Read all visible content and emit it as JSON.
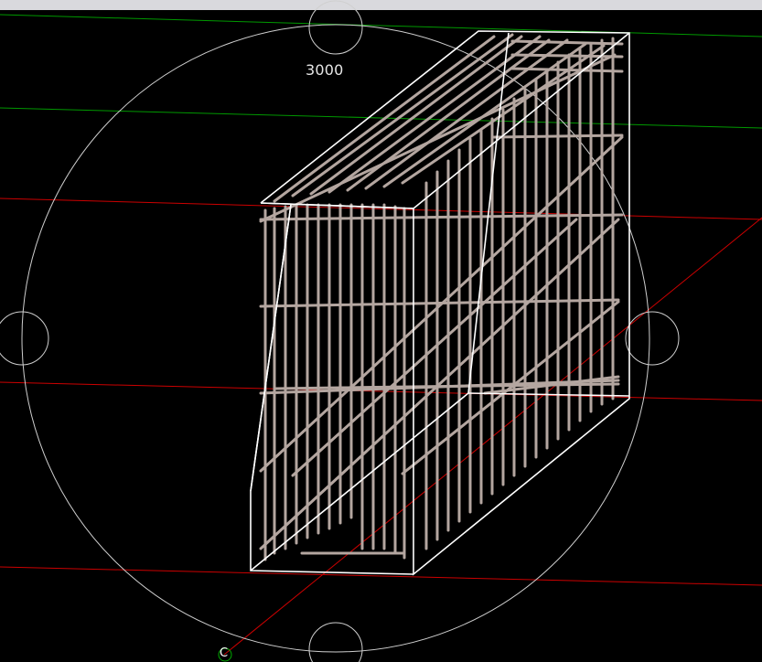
{
  "window": {
    "topbar_color": "#d9d9dd"
  },
  "viewport": {
    "background": "#000000",
    "dimension_label": "3000",
    "origin_marker_label": "C"
  },
  "colors": {
    "dim_circle": "#cfcfcf",
    "grid_red": "#cc0000",
    "grid_green": "#009900",
    "rebar": "#b4a6a0",
    "wall_outline": "#ffffff",
    "origin_marker": "#00aa00"
  },
  "icons": [
    "rotation-circle-icon",
    "origin-marker-icon"
  ]
}
